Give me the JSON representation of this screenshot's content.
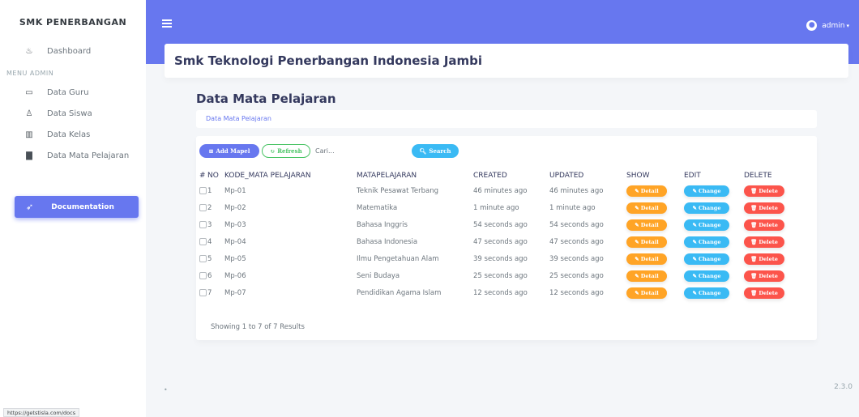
{
  "sidebar": {
    "brand": "SMK PENERBANGAN",
    "dashboard": {
      "label": "Dashboard",
      "icon": "fire-icon"
    },
    "menu_header": "MENU ADMIN",
    "items": [
      {
        "label": "Data Guru",
        "icon": "id-card-icon"
      },
      {
        "label": "Data Siswa",
        "icon": "user-icon"
      },
      {
        "label": "Data Kelas",
        "icon": "building-icon"
      },
      {
        "label": "Data Mata Pelajaran",
        "icon": "book-icon"
      }
    ],
    "documentation": {
      "label": "Documentation",
      "icon": "rocket-icon"
    }
  },
  "topbar": {
    "user": "admin"
  },
  "header": {
    "title": "Smk Teknologi Penerbangan Indonesia Jambi"
  },
  "section": {
    "title": "Data Mata Pelajaran",
    "breadcrumb": "Data Mata Pelajaran"
  },
  "toolbar": {
    "add_label": "Add Mapel",
    "refresh_label": "Refresh",
    "search_placeholder": "Cari...",
    "search_label": "Search"
  },
  "table": {
    "headers": [
      "#",
      "NO",
      "KODE_MATA PELAJARAN",
      "MATAPELAJARAN",
      "CREATED",
      "UPDATED",
      "SHOW",
      "EDIT",
      "DELETE"
    ],
    "rows": [
      {
        "no": "1",
        "kode": "Mp-01",
        "mapel": "Teknik Pesawat Terbang",
        "created": "46 minutes ago",
        "updated": "46 minutes ago"
      },
      {
        "no": "2",
        "kode": "Mp-02",
        "mapel": "Matematika",
        "created": "1 minute ago",
        "updated": "1 minute ago"
      },
      {
        "no": "3",
        "kode": "Mp-03",
        "mapel": "Bahasa Inggris",
        "created": "54 seconds ago",
        "updated": "54 seconds ago"
      },
      {
        "no": "4",
        "kode": "Mp-04",
        "mapel": "Bahasa Indonesia",
        "created": "47 seconds ago",
        "updated": "47 seconds ago"
      },
      {
        "no": "5",
        "kode": "Mp-05",
        "mapel": "Ilmu Pengetahuan Alam",
        "created": "39 seconds ago",
        "updated": "39 seconds ago"
      },
      {
        "no": "6",
        "kode": "Mp-06",
        "mapel": "Seni Budaya",
        "created": "25 seconds ago",
        "updated": "25 seconds ago"
      },
      {
        "no": "7",
        "kode": "Mp-07",
        "mapel": "Pendidikan Agama Islam",
        "created": "12 seconds ago",
        "updated": "12 seconds ago"
      }
    ],
    "detail_label": "Detail",
    "change_label": "Change",
    "delete_label": "Delete",
    "summary": "Showing 1 to 7 of 7 Results"
  },
  "footer": {
    "version": "2.3.0"
  },
  "status_url": "https://getstisla.com/docs",
  "colors": {
    "primary": "#6777ef",
    "warning": "#ffa426",
    "info": "#3abaf4",
    "danger": "#fc544b",
    "success": "#47c363"
  }
}
